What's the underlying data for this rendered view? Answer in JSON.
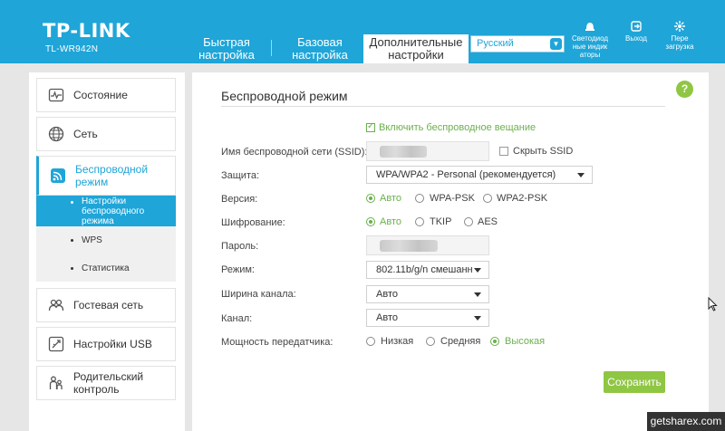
{
  "header": {
    "logo": "TP-LINK",
    "model": "TL-WR942N",
    "nav": [
      {
        "line1": "Быстрая",
        "line2": "настройка"
      },
      {
        "line1": "Базовая",
        "line2": "настройка"
      },
      {
        "line1": "Дополнительные",
        "line2": "настройки"
      }
    ],
    "language": "Русский",
    "buttons": {
      "led": {
        "line1": "Светодиод",
        "line2": "ные индик",
        "line3": "аторы"
      },
      "logout": {
        "line1": "Выход"
      },
      "reboot": {
        "line1": "Пере",
        "line2": "загрузка"
      }
    }
  },
  "sidebar": {
    "items": [
      {
        "label": "Состояние",
        "icon": "status-icon"
      },
      {
        "label": "Сеть",
        "icon": "globe-icon"
      },
      {
        "line1": "Беспроводной",
        "line2": "режим",
        "icon": "wifi-icon",
        "active": true
      },
      {
        "label": "Гостевая сеть",
        "icon": "guest-icon"
      },
      {
        "label": "Настройки USB",
        "icon": "usb-icon"
      },
      {
        "line1": "Родительский",
        "line2": "контроль",
        "icon": "parental-icon"
      }
    ],
    "subitems": [
      {
        "line1": "Настройки",
        "line2": "беспроводного",
        "line3": "режима",
        "selected": true
      },
      {
        "label": "WPS"
      },
      {
        "label": "Статистика"
      }
    ]
  },
  "form": {
    "title": "Беспроводной режим",
    "enable_broadcast": "Включить беспроводное вещание",
    "labels": {
      "ssid": "Имя беспроводной сети (SSID):",
      "security": "Защита:",
      "version": "Версия:",
      "encryption": "Шифрование:",
      "password": "Пароль:",
      "mode": "Режим:",
      "channel_width": "Ширина канала:",
      "channel": "Канал:",
      "tx_power": "Мощность передатчика:"
    },
    "hide_ssid": "Скрыть SSID",
    "security_value": "WPA/WPA2 - Personal (рекомендуется)",
    "version_options": [
      "Авто",
      "WPA-PSK",
      "WPA2-PSK"
    ],
    "encryption_options": [
      "Авто",
      "TKIP",
      "AES"
    ],
    "mode_value": "802.11b/g/n смешанн",
    "channel_width_value": "Авто",
    "channel_value": "Авто",
    "tx_power_options": [
      "Низкая",
      "Средняя",
      "Высокая"
    ],
    "save_label": "Сохранить"
  },
  "watermark": "getsharex.com",
  "colors": {
    "accent": "#1fa5d8",
    "green": "#8fc643",
    "radio_green": "#6ab04c"
  }
}
